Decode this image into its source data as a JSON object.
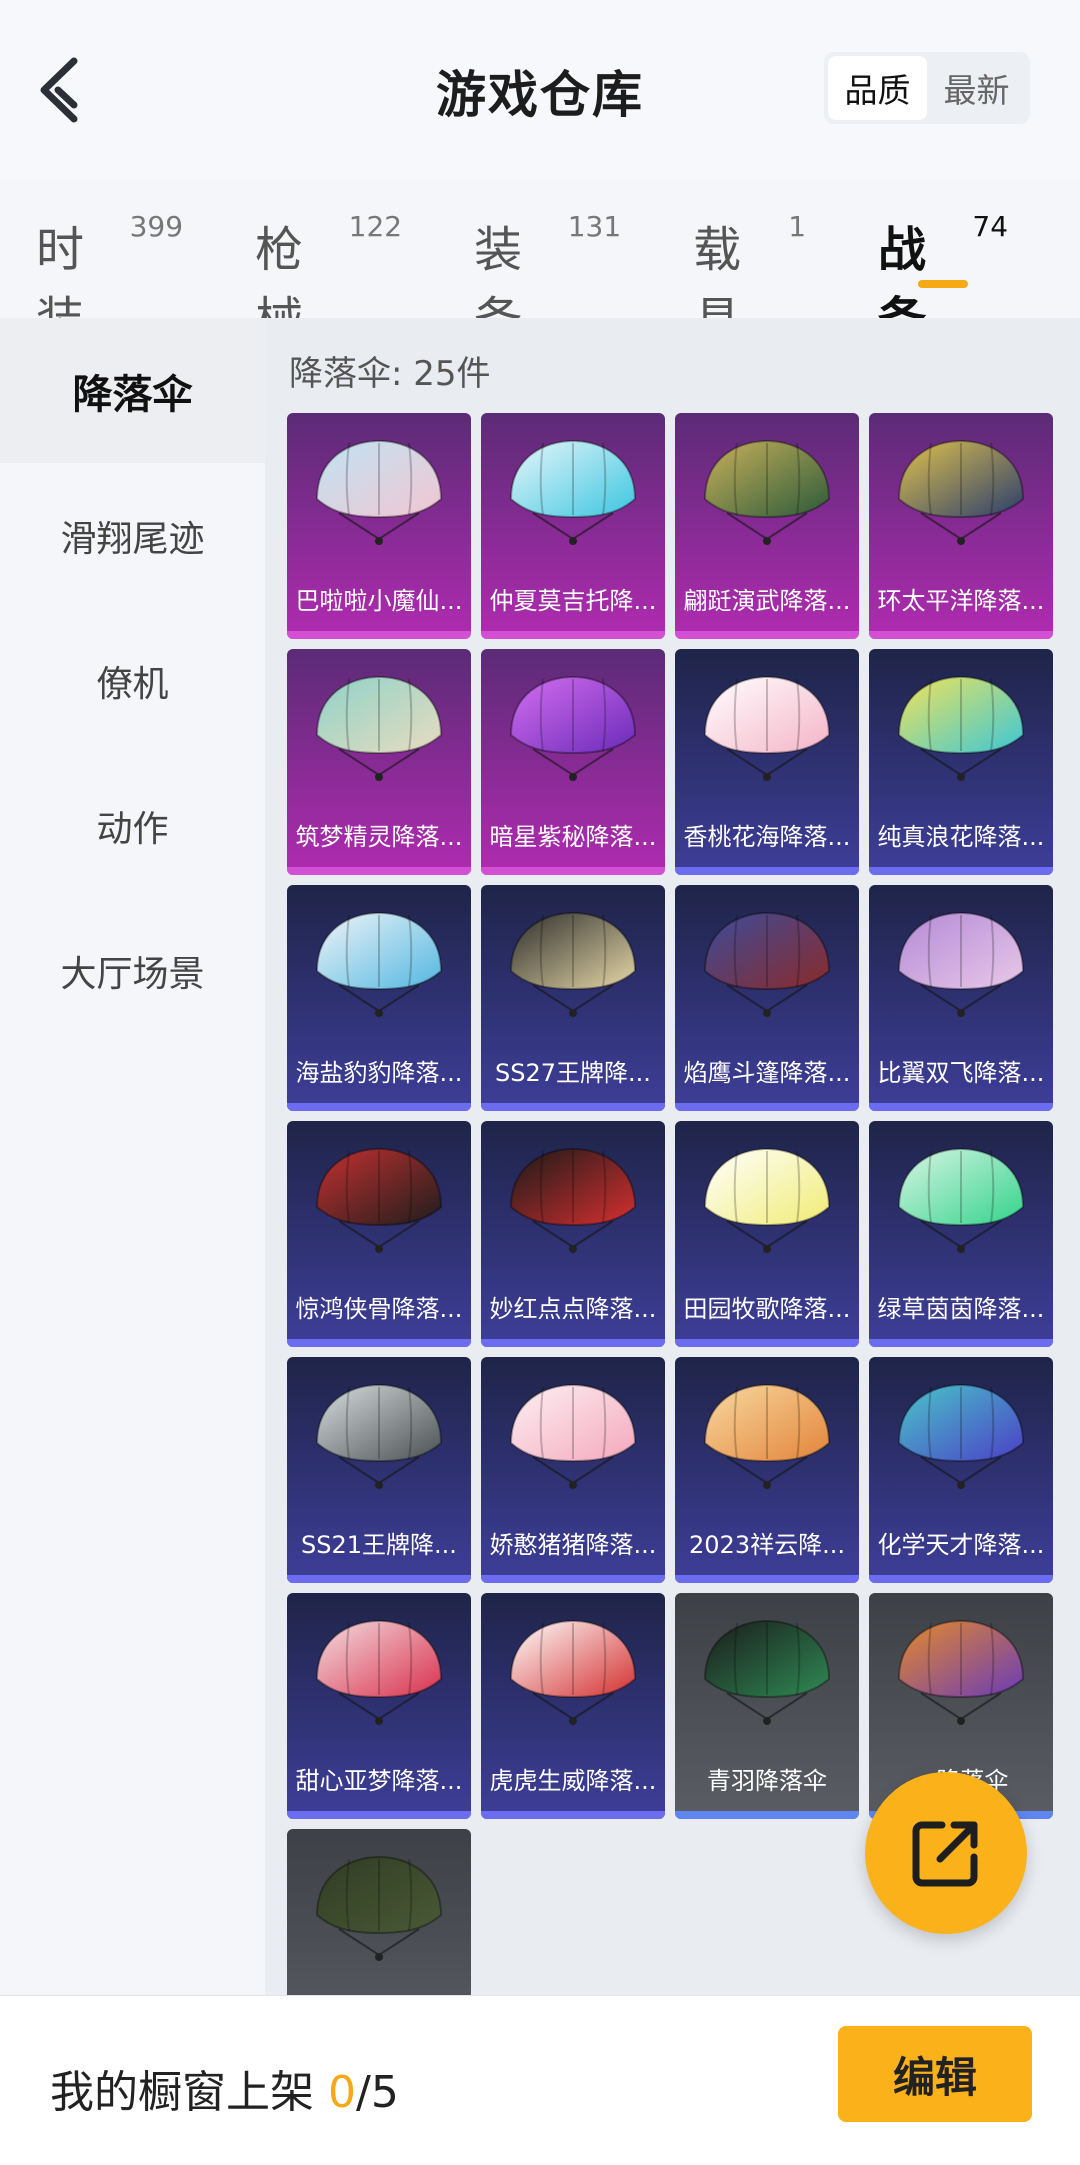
{
  "header": {
    "title": "游戏仓库",
    "sort_options": [
      "品质",
      "最新"
    ],
    "sort_selected": "品质"
  },
  "tabs": [
    {
      "label": "时装",
      "count": "399"
    },
    {
      "label": "枪械",
      "count": "122"
    },
    {
      "label": "装备",
      "count": "131"
    },
    {
      "label": "载具",
      "count": "1"
    },
    {
      "label": "战备",
      "count": "74"
    }
  ],
  "sidebar": {
    "items": [
      "降落伞",
      "滑翔尾迹",
      "僚机",
      "动作",
      "大厅场景"
    ],
    "active": "降落伞"
  },
  "content": {
    "count_label": "降落伞: 25件",
    "items": [
      {
        "name": "巴啦啦小魔仙...",
        "quality": "purple",
        "c1": "#f2c6d2",
        "c2": "#bfe3f2"
      },
      {
        "name": "仲夏莫吉托降...",
        "quality": "purple",
        "c1": "#3bc6e0",
        "c2": "#e8f6fa"
      },
      {
        "name": "翩跹演武降落...",
        "quality": "purple",
        "c1": "#2b5a3a",
        "c2": "#c9b15a"
      },
      {
        "name": "环太平洋降落...",
        "quality": "purple",
        "c1": "#2a3d6e",
        "c2": "#e0c24c"
      },
      {
        "name": "筑梦精灵降落...",
        "quality": "purple",
        "c1": "#e8dcc0",
        "c2": "#8fd2c8"
      },
      {
        "name": "暗星紫秘降落...",
        "quality": "purple",
        "c1": "#6a2bb8",
        "c2": "#d46ef0"
      },
      {
        "name": "香桃花海降落...",
        "quality": "blue",
        "c1": "#f4b4c8",
        "c2": "#ffffff"
      },
      {
        "name": "纯真浪花降落...",
        "quality": "blue",
        "c1": "#3cc7d6",
        "c2": "#f2e35a"
      },
      {
        "name": "海盐豹豹降落...",
        "quality": "blue",
        "c1": "#52b7e0",
        "c2": "#f0f4f8"
      },
      {
        "name": "SS27王牌降...",
        "quality": "blue",
        "c1": "#e6d8a8",
        "c2": "#2d2d2d"
      },
      {
        "name": "焰鹰斗篷降落...",
        "quality": "blue",
        "c1": "#8a2a2a",
        "c2": "#3c4c9a"
      },
      {
        "name": "比翼双飞降落...",
        "quality": "blue",
        "c1": "#e8c8e8",
        "c2": "#b48ad6"
      },
      {
        "name": "惊鸿侠骨降落...",
        "quality": "blue",
        "c1": "#1d1d1d",
        "c2": "#c43030"
      },
      {
        "name": "妙红点点降落...",
        "quality": "blue",
        "c1": "#d62f2f",
        "c2": "#1a1a1a"
      },
      {
        "name": "田园牧歌降落...",
        "quality": "blue",
        "c1": "#f0ec74",
        "c2": "#ffffff"
      },
      {
        "name": "绿草茵茵降落...",
        "quality": "blue",
        "c1": "#33d38c",
        "c2": "#d8f5e4"
      },
      {
        "name": "SS21王牌降...",
        "quality": "blue",
        "c1": "#4a5052",
        "c2": "#d8dde0"
      },
      {
        "name": "娇憨猪猪降落...",
        "quality": "blue",
        "c1": "#f4a8bc",
        "c2": "#fdf0f4"
      },
      {
        "name": "2023祥云降...",
        "quality": "blue",
        "c1": "#e2843a",
        "c2": "#f8d9a0"
      },
      {
        "name": "化学天才降落...",
        "quality": "blue",
        "c1": "#4b3fc6",
        "c2": "#4ac6c9"
      },
      {
        "name": "甜心亚梦降落...",
        "quality": "blue",
        "c1": "#d9304d",
        "c2": "#f3dde0"
      },
      {
        "name": "虎虎生威降落...",
        "quality": "blue",
        "c1": "#d32f2f",
        "c2": "#ffffff"
      },
      {
        "name": "青羽降落伞",
        "quality": "gray",
        "c1": "#2f8a55",
        "c2": "#1b1b1b"
      },
      {
        "name": "...降落伞",
        "quality": "gray",
        "c1": "#6a3bb8",
        "c2": "#e58a2a"
      },
      {
        "name": "",
        "quality": "gray",
        "c1": "#4a5a36",
        "c2": "#303c24"
      }
    ]
  },
  "bottom": {
    "label": "我的橱窗上架 ",
    "count_current": "0",
    "count_total": "/5",
    "edit_label": "编辑"
  },
  "colors": {
    "accent": "#fbb21a",
    "purple_quality": "#b02bb0",
    "blue_quality": "#3e3e99",
    "gray_quality": "#5a5e64"
  },
  "icons": [
    "back-icon",
    "share-icon",
    "parachute-icon"
  ]
}
